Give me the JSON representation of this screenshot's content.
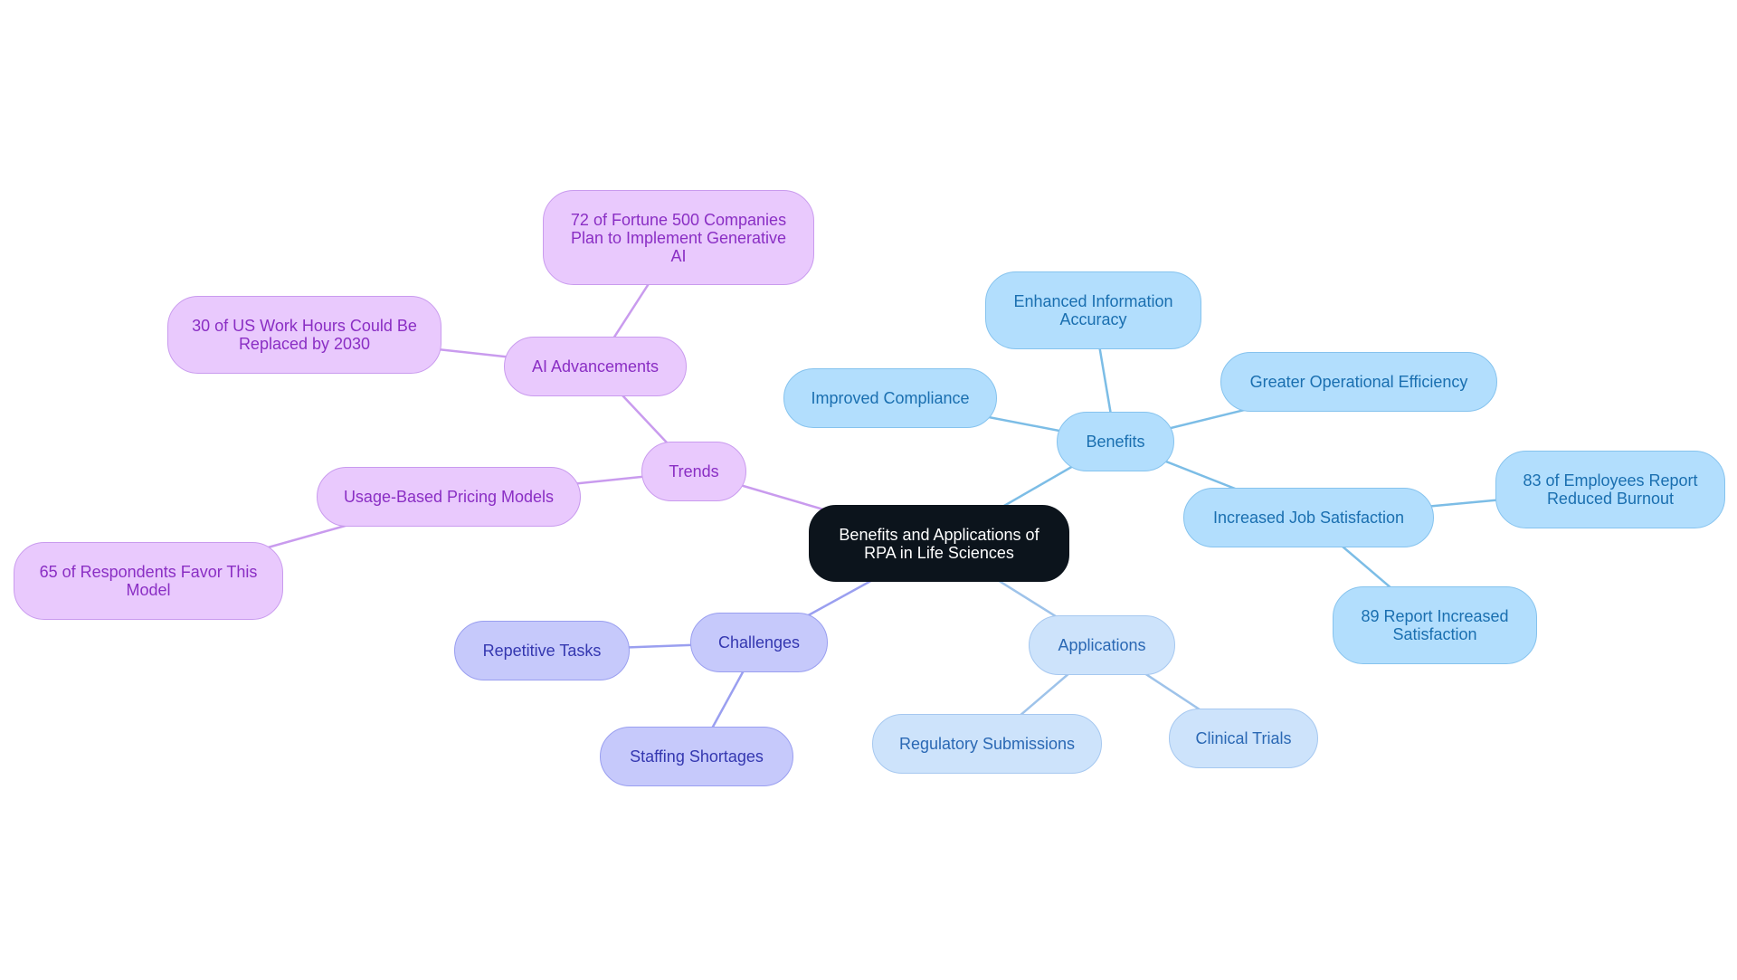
{
  "diagram": {
    "type": "mindmap",
    "root": {
      "id": "root",
      "label": "Benefits and Applications of RPA in Life Sciences"
    },
    "nodes": [
      {
        "id": "trends",
        "label": "Trends",
        "parent": "root",
        "theme": "purple"
      },
      {
        "id": "ai",
        "label": "AI Advancements",
        "parent": "trends",
        "theme": "purple"
      },
      {
        "id": "fortune",
        "label": "72 of Fortune 500 Companies Plan to Implement Generative AI",
        "parent": "ai",
        "theme": "purple"
      },
      {
        "id": "workhours",
        "label": "30 of US Work Hours Could Be Replaced by 2030",
        "parent": "ai",
        "theme": "purple"
      },
      {
        "id": "pricing",
        "label": "Usage-Based Pricing Models",
        "parent": "trends",
        "theme": "purple"
      },
      {
        "id": "respondents",
        "label": "65 of Respondents Favor This Model",
        "parent": "pricing",
        "theme": "purple"
      },
      {
        "id": "challenges",
        "label": "Challenges",
        "parent": "root",
        "theme": "indigo"
      },
      {
        "id": "repetitive",
        "label": "Repetitive Tasks",
        "parent": "challenges",
        "theme": "indigo"
      },
      {
        "id": "staffing",
        "label": "Staffing Shortages",
        "parent": "challenges",
        "theme": "indigo"
      },
      {
        "id": "benefits",
        "label": "Benefits",
        "parent": "root",
        "theme": "sky"
      },
      {
        "id": "accuracy",
        "label": "Enhanced Information Accuracy",
        "parent": "benefits",
        "theme": "sky"
      },
      {
        "id": "compliance",
        "label": "Improved Compliance",
        "parent": "benefits",
        "theme": "sky"
      },
      {
        "id": "efficiency",
        "label": "Greater Operational Efficiency",
        "parent": "benefits",
        "theme": "sky"
      },
      {
        "id": "jobsat",
        "label": "Increased Job Satisfaction",
        "parent": "benefits",
        "theme": "sky"
      },
      {
        "id": "burnout",
        "label": "83 of Employees Report Reduced Burnout",
        "parent": "jobsat",
        "theme": "sky"
      },
      {
        "id": "satisfaction",
        "label": "89 Report Increased Satisfaction",
        "parent": "jobsat",
        "theme": "sky"
      },
      {
        "id": "applications",
        "label": "Applications",
        "parent": "root",
        "theme": "pale"
      },
      {
        "id": "regulatory",
        "label": "Regulatory Submissions",
        "parent": "applications",
        "theme": "pale"
      },
      {
        "id": "clinical",
        "label": "Clinical Trials",
        "parent": "applications",
        "theme": "pale"
      }
    ],
    "colors": {
      "purple_edge": "#c99bee",
      "indigo_edge": "#9a9ff0",
      "sky_edge": "#7cbde6",
      "pale_edge": "#9ec3ea"
    }
  }
}
